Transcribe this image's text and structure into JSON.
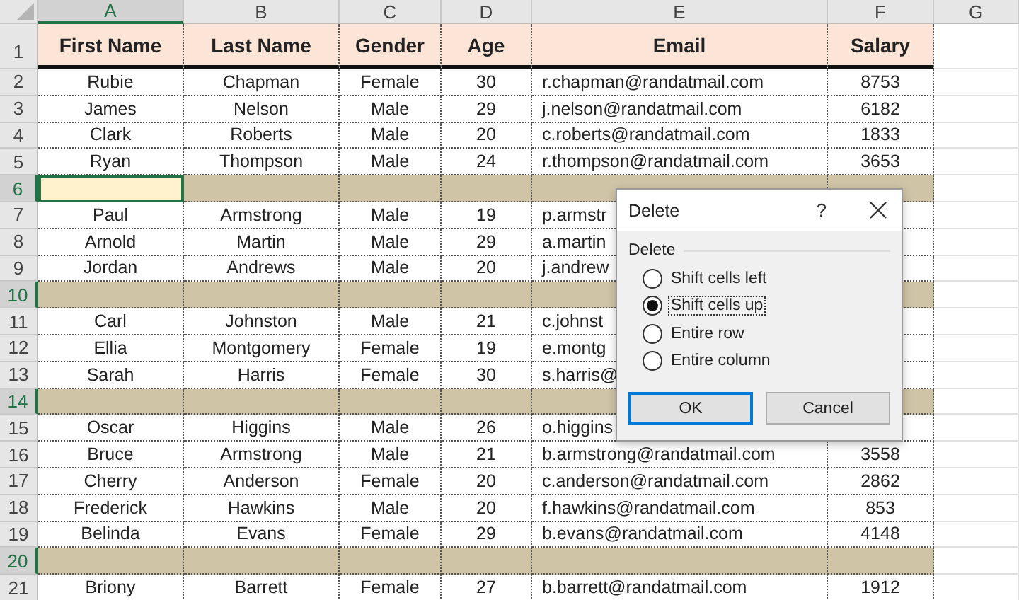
{
  "column_headers": [
    {
      "label": "A",
      "selected": true
    },
    {
      "label": "B",
      "selected": false
    },
    {
      "label": "C",
      "selected": false
    },
    {
      "label": "D",
      "selected": false
    },
    {
      "label": "E",
      "selected": false
    },
    {
      "label": "F",
      "selected": false
    },
    {
      "label": "G",
      "selected": false
    }
  ],
  "header_row": {
    "n": "1",
    "cells": [
      "First Name",
      "Last Name",
      "Gender",
      "Age",
      "Email",
      "Salary"
    ]
  },
  "rows": [
    {
      "n": "2",
      "kind": "data",
      "selected": false,
      "cells": [
        "Rubie",
        "Chapman",
        "Female",
        "30",
        "r.chapman@randatmail.com",
        "8753"
      ]
    },
    {
      "n": "3",
      "kind": "data",
      "selected": false,
      "cells": [
        "James",
        "Nelson",
        "Male",
        "29",
        "j.nelson@randatmail.com",
        "6182"
      ]
    },
    {
      "n": "4",
      "kind": "data",
      "selected": false,
      "cells": [
        "Clark",
        "Roberts",
        "Male",
        "20",
        "c.roberts@randatmail.com",
        "1833"
      ]
    },
    {
      "n": "5",
      "kind": "data",
      "selected": false,
      "cells": [
        "Ryan",
        "Thompson",
        "Male",
        "24",
        "r.thompson@randatmail.com",
        "3653"
      ]
    },
    {
      "n": "6",
      "kind": "blank",
      "selected": true,
      "active_cell": true
    },
    {
      "n": "7",
      "kind": "data",
      "selected": false,
      "cells": [
        "Paul",
        "Armstrong",
        "Male",
        "19",
        "p.armstr"
      ]
    },
    {
      "n": "8",
      "kind": "data",
      "selected": false,
      "cells": [
        "Arnold",
        "Martin",
        "Male",
        "29",
        "a.martin"
      ]
    },
    {
      "n": "9",
      "kind": "data",
      "selected": false,
      "cells": [
        "Jordan",
        "Andrews",
        "Male",
        "20",
        "j.andrew"
      ]
    },
    {
      "n": "10",
      "kind": "blank",
      "selected": true,
      "active_cell": false
    },
    {
      "n": "11",
      "kind": "data",
      "selected": false,
      "cells": [
        "Carl",
        "Johnston",
        "Male",
        "21",
        "c.johnst"
      ]
    },
    {
      "n": "12",
      "kind": "data",
      "selected": false,
      "cells": [
        "Ellia",
        "Montgomery",
        "Female",
        "19",
        "e.montg"
      ]
    },
    {
      "n": "13",
      "kind": "data",
      "selected": false,
      "cells": [
        "Sarah",
        "Harris",
        "Female",
        "30",
        "s.harris@"
      ]
    },
    {
      "n": "14",
      "kind": "blank",
      "selected": true,
      "active_cell": false
    },
    {
      "n": "15",
      "kind": "data",
      "selected": false,
      "cells": [
        "Oscar",
        "Higgins",
        "Male",
        "26",
        "o.higgins"
      ]
    },
    {
      "n": "16",
      "kind": "data",
      "selected": false,
      "cells": [
        "Bruce",
        "Armstrong",
        "Male",
        "21",
        "b.armstrong@randatmail.com",
        "3558"
      ]
    },
    {
      "n": "17",
      "kind": "data",
      "selected": false,
      "cells": [
        "Cherry",
        "Anderson",
        "Female",
        "20",
        "c.anderson@randatmail.com",
        "2862"
      ]
    },
    {
      "n": "18",
      "kind": "data",
      "selected": false,
      "cells": [
        "Frederick",
        "Hawkins",
        "Male",
        "20",
        "f.hawkins@randatmail.com",
        "853"
      ]
    },
    {
      "n": "19",
      "kind": "data",
      "selected": false,
      "cells": [
        "Belinda",
        "Evans",
        "Female",
        "29",
        "b.evans@randatmail.com",
        "4148"
      ]
    },
    {
      "n": "20",
      "kind": "blank",
      "selected": true,
      "active_cell": false
    },
    {
      "n": "21",
      "kind": "data",
      "selected": false,
      "cells": [
        "Briony",
        "Barrett",
        "Female",
        "27",
        "b.barrett@randatmail.com",
        "1912"
      ]
    }
  ],
  "dialog": {
    "title": "Delete",
    "help": "?",
    "group": "Delete",
    "options": [
      {
        "label": "Shift cells left",
        "selected": false
      },
      {
        "label": "Shift cells up",
        "selected": true
      },
      {
        "label": "Entire row",
        "selected": false
      },
      {
        "label": "Entire column",
        "selected": false
      }
    ],
    "buttons": [
      {
        "label": "OK",
        "default": true
      },
      {
        "label": "Cancel",
        "default": false
      }
    ]
  }
}
